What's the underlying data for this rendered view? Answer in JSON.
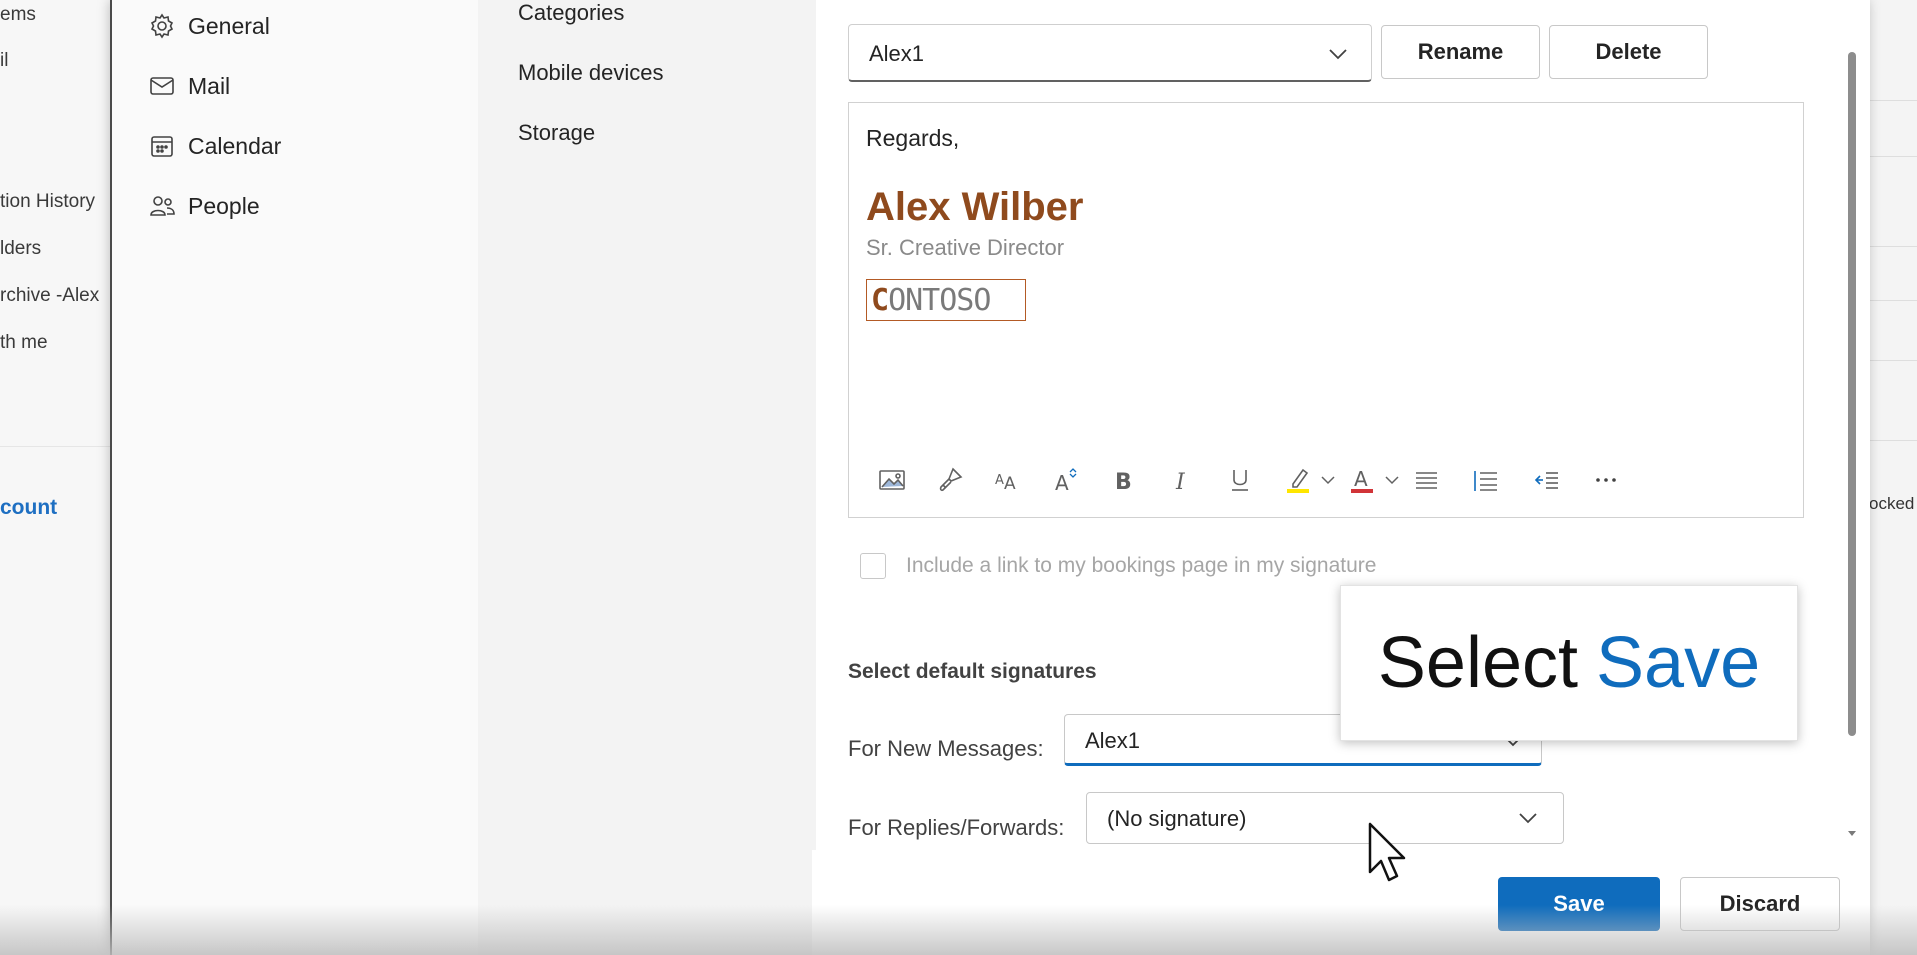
{
  "background_left": {
    "items": [
      "ems",
      "il",
      "tion History",
      "lders",
      "rchive -Alex",
      "th me"
    ],
    "account_label": "count"
  },
  "background_right": {
    "partial_text": "ocked"
  },
  "nav_primary": {
    "items": [
      {
        "label": "General",
        "icon": "gear-icon"
      },
      {
        "label": "Mail",
        "icon": "mail-icon"
      },
      {
        "label": "Calendar",
        "icon": "calendar-icon"
      },
      {
        "label": "People",
        "icon": "people-icon"
      }
    ]
  },
  "nav_secondary": {
    "items": [
      "Categories",
      "Mobile devices",
      "Storage"
    ]
  },
  "signature": {
    "selected_name": "Alex1",
    "rename_label": "Rename",
    "delete_label": "Delete",
    "body": {
      "regards": "Regards,",
      "name": "Alex Wilber",
      "title": "Sr. Creative Director",
      "logo_first": "C",
      "logo_rest": "ONTOSO"
    },
    "toolbar": [
      "insert-image-icon",
      "format-painter-icon",
      "font-size-icon",
      "change-case-icon",
      "bold-icon",
      "italic-icon",
      "underline-icon",
      "highlight-icon",
      "highlight-dropdown-icon",
      "font-color-icon",
      "font-color-dropdown-icon",
      "bullets-icon",
      "numbering-icon",
      "decrease-indent-icon",
      "more-options-icon"
    ],
    "bookings_checkbox_label": "Include a link to my bookings page in my signature"
  },
  "defaults": {
    "section_title": "Select default signatures",
    "new_messages_label": "For New Messages:",
    "new_messages_value": "Alex1",
    "replies_label": "For Replies/Forwards:",
    "replies_value": "(No signature)"
  },
  "callout": {
    "prefix": "Select",
    "highlight": "Save"
  },
  "footer": {
    "save_label": "Save",
    "discard_label": "Discard"
  },
  "colors": {
    "accent": "#0f6cbd",
    "signature_name": "#8f4a1d"
  }
}
